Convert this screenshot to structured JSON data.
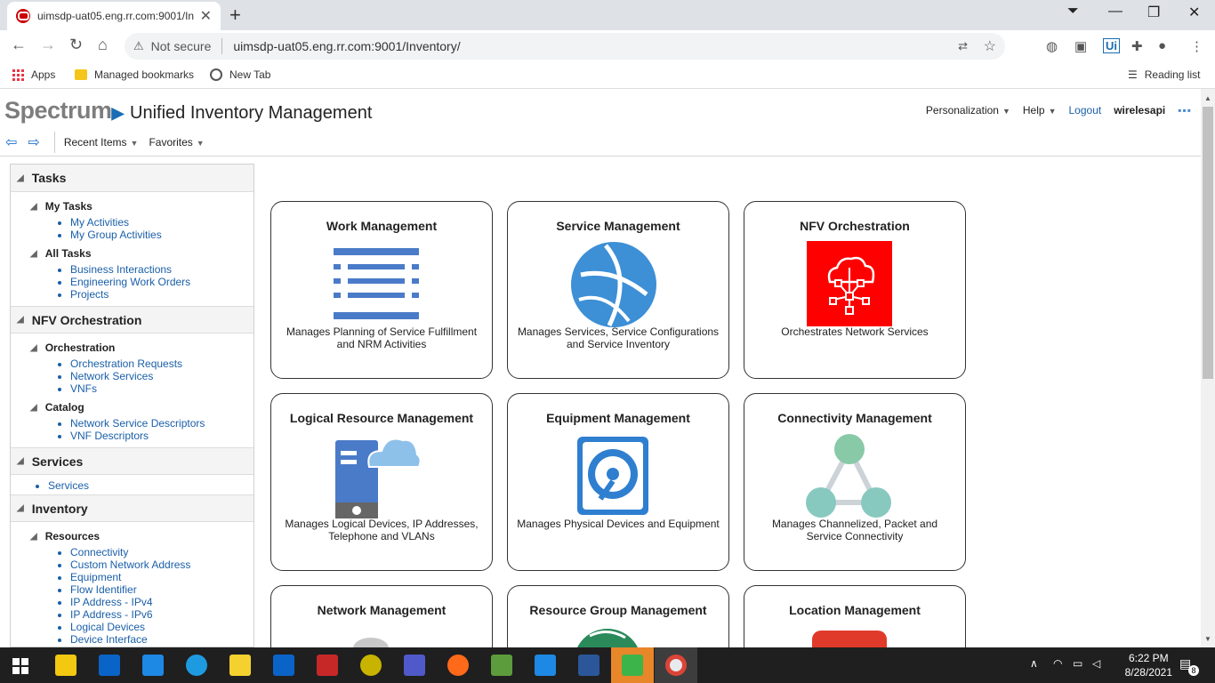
{
  "browser": {
    "tab_title": "uimsdp-uat05.eng.rr.com:9001/In",
    "not_secure": "Not secure",
    "url": "uimsdp-uat05.eng.rr.com:9001/Inventory/",
    "bookmarks": [
      "Apps",
      "Managed bookmarks",
      "New Tab"
    ],
    "reading_list": "Reading list"
  },
  "header": {
    "logo": "Spectrum",
    "app_title": "Unified Inventory Management",
    "personalization": "Personalization",
    "help": "Help",
    "logout": "Logout",
    "user": "wirelesapi",
    "recent_items": "Recent Items",
    "favorites": "Favorites"
  },
  "sidebar": {
    "tasks": {
      "title": "Tasks",
      "my_tasks": {
        "title": "My Tasks",
        "items": [
          "My Activities",
          "My Group Activities"
        ]
      },
      "all_tasks": {
        "title": "All Tasks",
        "items": [
          "Business Interactions",
          "Engineering Work Orders",
          "Projects"
        ]
      }
    },
    "nfv": {
      "title": "NFV Orchestration",
      "orchestration": {
        "title": "Orchestration",
        "items": [
          "Orchestration Requests",
          "Network Services",
          "VNFs"
        ]
      },
      "catalog": {
        "title": "Catalog",
        "items": [
          "Network Service Descriptors",
          "VNF Descriptors"
        ]
      }
    },
    "services": {
      "title": "Services",
      "items": [
        "Services"
      ]
    },
    "inventory": {
      "title": "Inventory",
      "resources": {
        "title": "Resources",
        "items": [
          "Connectivity",
          "Custom Network Address",
          "Equipment",
          "Flow Identifier",
          "IP Address - IPv4",
          "IP Address - IPv6",
          "Logical Devices",
          "Device Interface"
        ]
      }
    }
  },
  "cards": {
    "work": {
      "title": "Work Management",
      "desc": "Manages Planning of Service Fulfillment and NRM Activities"
    },
    "service": {
      "title": "Service Management",
      "desc": "Manages Services, Service Configurations and Service Inventory"
    },
    "nfv": {
      "title": "NFV Orchestration",
      "desc": "Orchestrates Network Services"
    },
    "logical": {
      "title": "Logical Resource Management",
      "desc": "Manages Logical Devices, IP Addresses, Telephone and VLANs"
    },
    "equipment": {
      "title": "Equipment Management",
      "desc": "Manages Physical Devices and Equipment"
    },
    "connectivity": {
      "title": "Connectivity Management",
      "desc": "Manages Channelized, Packet and Service Connectivity"
    },
    "network": {
      "title": "Network Management",
      "desc": ""
    },
    "resource_group": {
      "title": "Resource Group Management",
      "desc": ""
    },
    "location": {
      "title": "Location Management",
      "desc": ""
    }
  },
  "taskbar": {
    "time": "6:22 PM",
    "date": "8/28/2021",
    "notifications": "8"
  },
  "colors": {
    "link": "#1a5fa8",
    "brand_blue": "#1a6db5",
    "nfv_red": "#ff0000",
    "service_blue": "#3d8fd6"
  }
}
